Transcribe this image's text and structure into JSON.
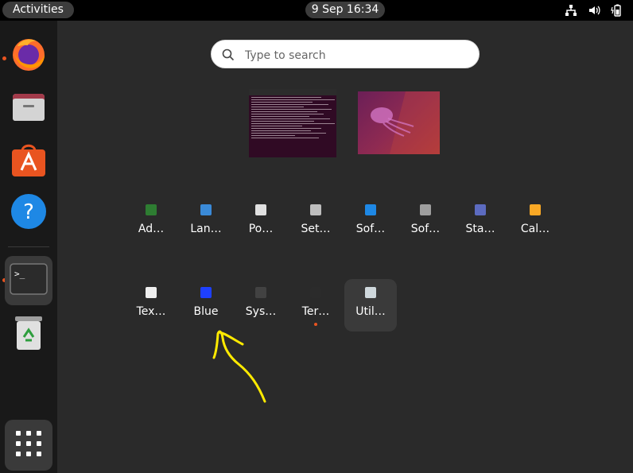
{
  "topbar": {
    "activities_label": "Activities",
    "clock": "9 Sep  16:34",
    "tray_icons": [
      "network-icon",
      "volume-icon",
      "battery-icon"
    ]
  },
  "dock": {
    "items": [
      {
        "name": "firefox",
        "icon": "firefox-icon",
        "running": true
      },
      {
        "name": "files",
        "icon": "files-icon",
        "running": false
      },
      {
        "name": "software",
        "icon": "software-icon",
        "running": false
      },
      {
        "name": "help",
        "icon": "help-icon",
        "running": false
      },
      {
        "name": "terminal",
        "icon": "terminal-icon",
        "running": true,
        "active": true
      },
      {
        "name": "trash",
        "icon": "trash-icon",
        "running": false
      },
      {
        "name": "show-apps",
        "icon": "grid-icon"
      }
    ]
  },
  "search": {
    "placeholder": "Type to search"
  },
  "apps_row1": [
    {
      "label": "Ad…",
      "color": "#2e7d32"
    },
    {
      "label": "Lan…",
      "color": "#3a8ad8"
    },
    {
      "label": "Po…",
      "color": "#e0e0e0"
    },
    {
      "label": "Set…",
      "color": "#bdbdbd"
    },
    {
      "label": "Sof…",
      "color": "#1e88e5"
    },
    {
      "label": "Sof…",
      "color": "#9e9e9e"
    },
    {
      "label": "Sta…",
      "color": "#5c6bc0"
    },
    {
      "label": "Cal…",
      "color": "#f9a825"
    }
  ],
  "apps_row2": [
    {
      "label": "Tex…",
      "color": "#eeeeee"
    },
    {
      "label": "Blue",
      "color": "#1e40ff"
    },
    {
      "label": "Sys…",
      "color": "#424242"
    },
    {
      "label": "Ter…",
      "color": "#2b2b2b",
      "running": true
    },
    {
      "label": "Util…",
      "color": "#cfd8dc",
      "highlighted": true
    }
  ],
  "annotation": {
    "color": "#ffea00"
  }
}
